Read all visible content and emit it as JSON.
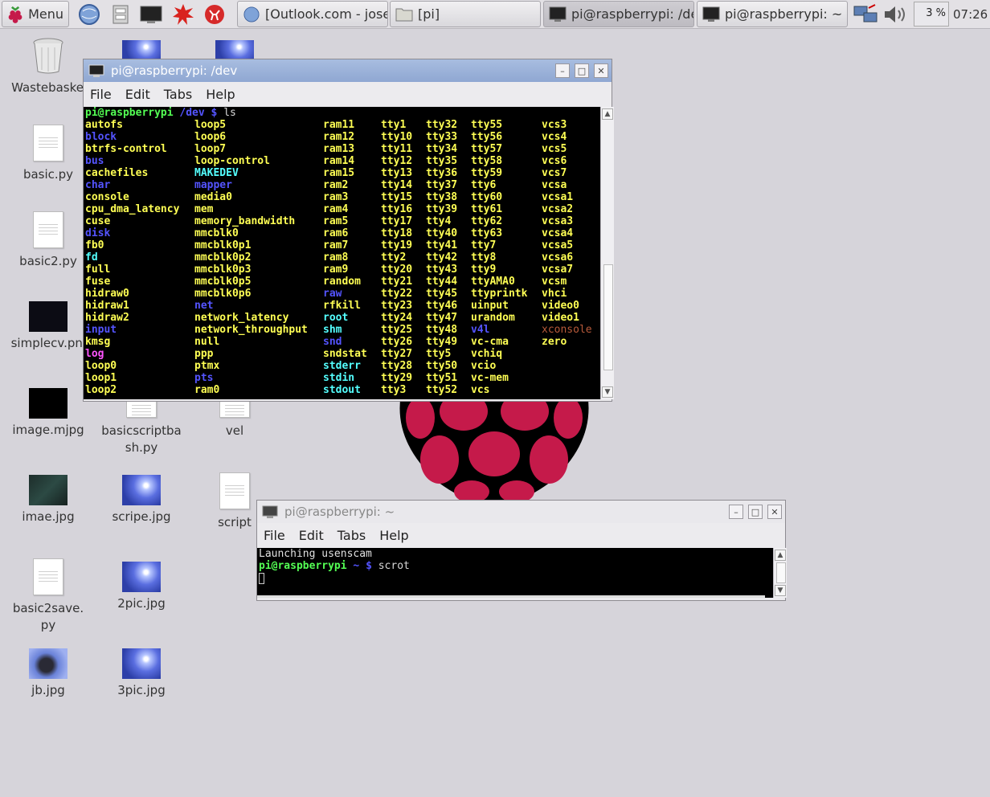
{
  "panel": {
    "menu_label": "Menu",
    "tasks": [
      {
        "label": "[Outlook.com - jose....",
        "icon": "browser-icon"
      },
      {
        "label": "[pi]",
        "icon": "folder-icon"
      },
      {
        "label": "pi@raspberrypi: /dev",
        "icon": "terminal-icon"
      },
      {
        "label": "pi@raspberrypi: ~",
        "icon": "terminal-icon"
      }
    ],
    "cpu": "3 %",
    "clock": "07:26"
  },
  "desktop": {
    "icons": [
      {
        "label": "Wastebasket"
      },
      {
        "label": "basic.py"
      },
      {
        "label": "basic2.py"
      },
      {
        "label": "simplecv.png"
      },
      {
        "label": "image.mjpg"
      },
      {
        "label": "imae.jpg"
      },
      {
        "label": "basic2save.py"
      },
      {
        "label": "jb.jpg"
      },
      {
        "label": "basicscriptbash.py"
      },
      {
        "label": "scripe.jpg"
      },
      {
        "label": "2pic.jpg"
      },
      {
        "label": "3pic.jpg"
      },
      {
        "label": "vel"
      },
      {
        "label": "script"
      }
    ]
  },
  "win_dev": {
    "title": "pi@raspberrypi: /dev",
    "menu": [
      "File",
      "Edit",
      "Tabs",
      "Help"
    ],
    "prompt_user": "pi@raspberrypi",
    "prompt_path": "/dev",
    "prompt_sym": "$",
    "command": "ls",
    "columns": [
      [
        "autofs",
        "block",
        "btrfs-control",
        "bus",
        "cachefiles",
        "char",
        "console",
        "cpu_dma_latency",
        "cuse",
        "disk",
        "fb0",
        "fd",
        "full",
        "fuse",
        "hidraw0",
        "hidraw1",
        "hidraw2",
        "input",
        "kmsg",
        "log",
        "loop0",
        "loop1",
        "loop2"
      ],
      [
        "loop5",
        "loop6",
        "loop7",
        "loop-control",
        "MAKEDEV",
        "mapper",
        "media0",
        "mem",
        "memory_bandwidth",
        "mmcblk0",
        "mmcblk0p1",
        "mmcblk0p2",
        "mmcblk0p3",
        "mmcblk0p5",
        "mmcblk0p6",
        "net",
        "network_latency",
        "network_throughput",
        "null",
        "ppp",
        "ptmx",
        "pts",
        "ram0"
      ],
      [
        "ram11",
        "ram12",
        "ram13",
        "ram14",
        "ram15",
        "ram2",
        "ram3",
        "ram4",
        "ram5",
        "ram6",
        "ram7",
        "ram8",
        "ram9",
        "random",
        "raw",
        "rfkill",
        "root",
        "shm",
        "snd",
        "sndstat",
        "stderr",
        "stdin",
        "stdout"
      ],
      [
        "tty1",
        "tty10",
        "tty11",
        "tty12",
        "tty13",
        "tty14",
        "tty15",
        "tty16",
        "tty17",
        "tty18",
        "tty19",
        "tty2",
        "tty20",
        "tty21",
        "tty22",
        "tty23",
        "tty24",
        "tty25",
        "tty26",
        "tty27",
        "tty28",
        "tty29",
        "tty3"
      ],
      [
        "tty32",
        "tty33",
        "tty34",
        "tty35",
        "tty36",
        "tty37",
        "tty38",
        "tty39",
        "tty4",
        "tty40",
        "tty41",
        "tty42",
        "tty43",
        "tty44",
        "tty45",
        "tty46",
        "tty47",
        "tty48",
        "tty49",
        "tty5",
        "tty50",
        "tty51",
        "tty52"
      ],
      [
        "tty55",
        "tty56",
        "tty57",
        "tty58",
        "tty59",
        "tty6",
        "tty60",
        "tty61",
        "tty62",
        "tty63",
        "tty7",
        "tty8",
        "tty9",
        "ttyAMA0",
        "ttyprintk",
        "uinput",
        "urandom",
        "v4l",
        "vc-cma",
        "vchiq",
        "vcio",
        "vc-mem",
        "vcs"
      ],
      [
        "vcs3",
        "vcs4",
        "vcs5",
        "vcs6",
        "vcs7",
        "vcsa",
        "vcsa1",
        "vcsa2",
        "vcsa3",
        "vcsa4",
        "vcsa5",
        "vcsa6",
        "vcsa7",
        "vcsm",
        "vhci",
        "video0",
        "video1",
        "xconsole",
        "zero"
      ]
    ],
    "colors": {
      "device": "#ffff54",
      "directory": "#5454ff",
      "link": "#54ffff",
      "pipe": "#b85a3a",
      "socket": "#ff54ff",
      "plain": "#e0e0e0"
    },
    "color_map": {
      "block": "directory",
      "bus": "directory",
      "char": "directory",
      "disk": "directory",
      "input": "directory",
      "mapper": "directory",
      "net": "directory",
      "pts": "directory",
      "raw": "directory",
      "snd": "directory",
      "v4l": "directory",
      "fd": "link",
      "log": "socket",
      "MAKEDEV": "link",
      "root": "link",
      "shm": "link",
      "stderr": "link",
      "stdin": "link",
      "stdout": "link",
      "xconsole": "pipe"
    }
  },
  "win_home": {
    "title": "pi@raspberrypi: ~",
    "menu": [
      "File",
      "Edit",
      "Tabs",
      "Help"
    ],
    "line1": "Launching usenscam",
    "prompt_user": "pi@raspberrypi",
    "prompt_path": "~",
    "prompt_sym": "$",
    "command": "scrot"
  }
}
